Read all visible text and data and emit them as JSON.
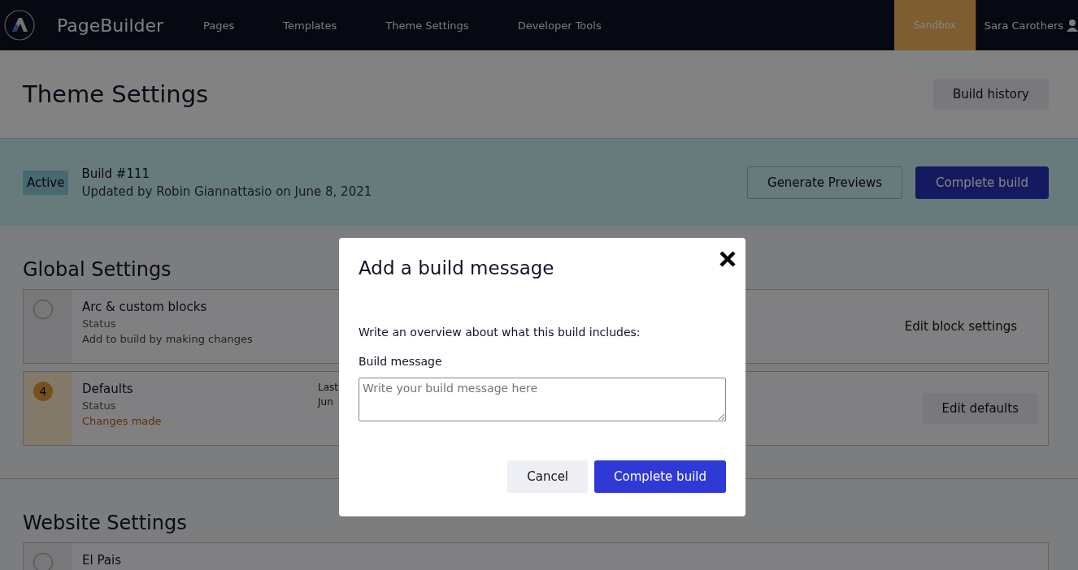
{
  "nav": {
    "brand": "PageBuilder",
    "items": [
      {
        "label": "Pages",
        "selected": false
      },
      {
        "label": "Templates",
        "selected": false
      },
      {
        "label": "Theme Settings",
        "selected": false
      },
      {
        "label": "Developer Tools",
        "selected": false
      }
    ],
    "environment": "Sandbox",
    "user": "Sara Carothers"
  },
  "header": {
    "title": "Theme Settings",
    "action": "Build history"
  },
  "build": {
    "badge": "Active",
    "title": "Build #111",
    "subtitle": "Updated by Robin Giannattasio on June 8, 2021",
    "buttons": [
      {
        "label": "Generate Previews",
        "kind": "secondary"
      },
      {
        "label": "Complete build",
        "kind": "primary"
      }
    ]
  },
  "global_settings": {
    "title": "Global Settings",
    "cards": [
      {
        "name": "Arc & custom blocks",
        "kind": "unchanged",
        "status_label": "Status",
        "status": "Add to build by making changes",
        "action": "Edit block settings"
      },
      {
        "name": "Defaults",
        "kind": "changed",
        "count": "4",
        "status_label": "Status",
        "status": "Changes made",
        "column_3_label": "Last",
        "column_3_value": "Jun",
        "action": "Edit defaults"
      }
    ]
  },
  "website_settings": {
    "title": "Website Settings",
    "cards": [
      {
        "name": "El Pais",
        "kind": "unchanged"
      }
    ]
  },
  "dialog": {
    "title": "Add a build message",
    "intro": "Write an overview about what this build includes:",
    "field_label": "Build message",
    "placeholder": "Write your build message here",
    "buttons": [
      {
        "label": "Cancel",
        "kind": "secondary"
      },
      {
        "label": "Complete build",
        "kind": "primary"
      }
    ]
  }
}
